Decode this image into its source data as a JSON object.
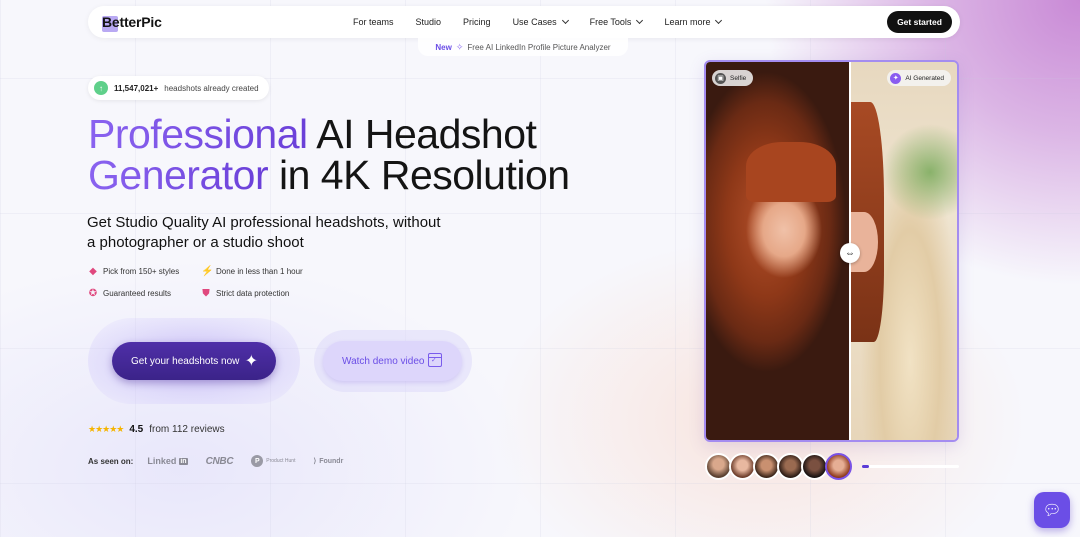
{
  "nav": {
    "logo": "BetterPic",
    "links": [
      {
        "label": "For teams",
        "dropdown": false
      },
      {
        "label": "Studio",
        "dropdown": false
      },
      {
        "label": "Pricing",
        "dropdown": false
      },
      {
        "label": "Use Cases",
        "dropdown": true
      },
      {
        "label": "Free Tools",
        "dropdown": true
      },
      {
        "label": "Learn more",
        "dropdown": true
      }
    ],
    "cta": "Get started"
  },
  "announcement": {
    "badge": "New",
    "text": "Free AI LinkedIn Profile Picture Analyzer"
  },
  "counter": {
    "number": "11,547,021+",
    "text": "headshots already created"
  },
  "headline": {
    "line1_accent": "Professional",
    "line1_rest": " AI Headshot",
    "line2_accent": "Generator",
    "line2_rest": " in 4K Resolution"
  },
  "subheadline": "Get Studio Quality AI professional headshots, without a photographer or a studio shoot",
  "features": [
    {
      "icon": "palette-icon",
      "label": "Pick from 150+ styles"
    },
    {
      "icon": "lightning-icon",
      "label": "Done in less than 1 hour"
    },
    {
      "icon": "award-icon",
      "label": "Guaranteed results"
    },
    {
      "icon": "shield-icon",
      "label": "Strict data protection"
    }
  ],
  "cta_primary": "Get your headshots now",
  "cta_secondary": "Watch demo video",
  "rating": {
    "stars": 4.5,
    "score": "4.5",
    "text": "from 112 reviews"
  },
  "seen_on": {
    "label": "As seen on:",
    "brands": [
      "Linked",
      "in",
      "CNBC",
      "P",
      "Product Hunt",
      "Foundr"
    ]
  },
  "compare": {
    "left_tag": "Selfie",
    "right_tag": "AI Generated"
  },
  "thumbnails": {
    "count": 6,
    "selected_index": 5
  },
  "slider_progress": 0.07,
  "colors": {
    "accent": "#6b4ee6",
    "primary_button": "#3b2389",
    "star": "#f5b400",
    "nav_cta": "#111111"
  }
}
